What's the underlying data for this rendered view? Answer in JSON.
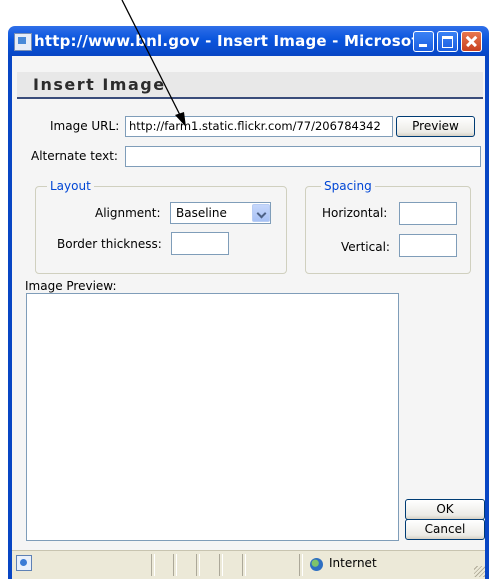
{
  "window": {
    "title": "http://www.bnl.gov - Insert Image - Microsof..."
  },
  "dialog": {
    "header": "Insert Image",
    "image_url_label": "Image URL:",
    "image_url_value": "http://farm1.static.flickr.com/77/206784342",
    "preview_button": "Preview",
    "alt_text_label": "Alternate text:",
    "alt_text_value": "",
    "layout": {
      "legend": "Layout",
      "alignment_label": "Alignment:",
      "alignment_value": "Baseline",
      "border_label": "Border thickness:",
      "border_value": ""
    },
    "spacing": {
      "legend": "Spacing",
      "horizontal_label": "Horizontal:",
      "horizontal_value": "",
      "vertical_label": "Vertical:",
      "vertical_value": ""
    },
    "image_preview_label": "Image Preview:",
    "ok_button": "OK",
    "cancel_button": "Cancel"
  },
  "status_bar": {
    "zone": "Internet"
  },
  "colors": {
    "titlebar": "#0a55dd",
    "legend": "#0046d5",
    "window_bg": "#ece9d8"
  }
}
